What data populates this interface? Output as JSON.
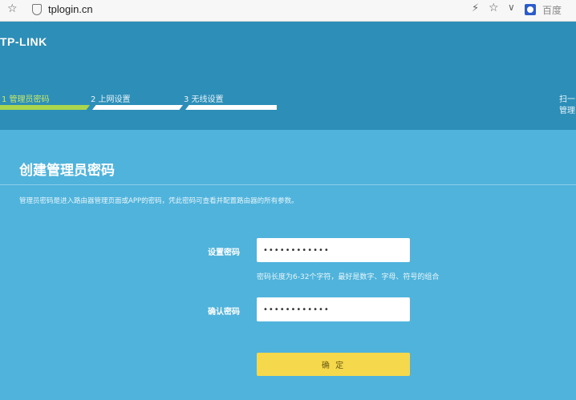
{
  "browser": {
    "url": "tplogin.cn",
    "search_engine": "百度"
  },
  "header": {
    "logo": "TP-LINK",
    "steps": [
      {
        "label": "1 管理员密码",
        "active": true
      },
      {
        "label": "2 上网设置",
        "active": false
      },
      {
        "label": "3 无线设置",
        "active": false
      }
    ],
    "side_text_1": "扫一",
    "side_text_2": "管理"
  },
  "main": {
    "title": "创建管理员密码",
    "description": "管理员密码是进入路由器管理页面或APP的密码，凭此密码可查看并配置路由器的所有参数。",
    "set_password_label": "设置密码",
    "set_password_value": "••••••••••••",
    "hint": "密码长度为6-32个字符，最好是数字、字母、符号的组合",
    "confirm_password_label": "确认密码",
    "confirm_password_value": "••••••••••••",
    "confirm_button": "确 定"
  },
  "colors": {
    "header_bg": "#2d8fb8",
    "content_bg": "#4fb3dc",
    "active_step": "#a9d64c",
    "button": "#f5d84c"
  }
}
